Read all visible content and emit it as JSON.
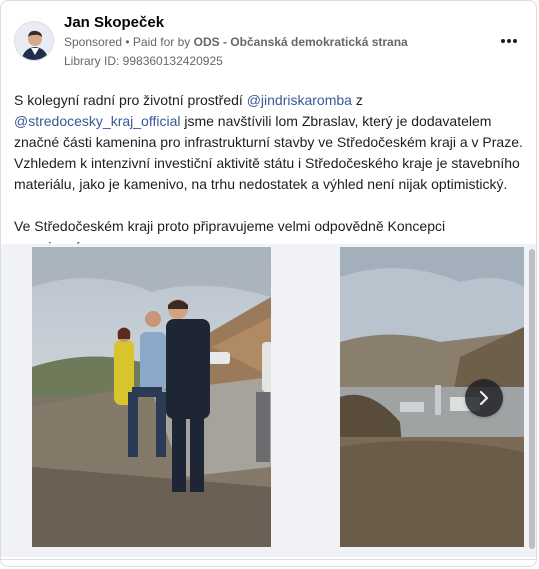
{
  "post": {
    "author": "Jan Skopeček",
    "sponsored": "Sponsored",
    "paid_prefix": "• Paid for by",
    "paid_by": "ODS - Občanská demokratická strana",
    "library_id": "Library ID: 998360132420925",
    "text": {
      "p1_a": "S kolegyní radní pro životní prostředí ",
      "mention1": "@jindriskaromba",
      "p1_b": " z ",
      "mention2": "@stredocesky_kraj_official",
      "p1_c": " jsme navštívili lom Zbraslav, který je dodavatelem značné části kamenina pro infrastrukturní stavby ve Středočeském kraji a v Praze. Vzhledem k intenzivní investiční aktivitě státu i Středočeského kraje je stavebního materiálu, jako je kamenivo, na trhu nedostatek a výhled není nijak optimistický.",
      "p2": "Ve Středočeském kraji proto připravujeme velmi odpovědně Koncepci surovinové…"
    }
  },
  "colors": {
    "mention": "#385898",
    "meta": "#65676b",
    "next_button": "#1c1e21"
  },
  "icons": {
    "more": "three-dots-icon",
    "next": "chevron-right-icon"
  }
}
